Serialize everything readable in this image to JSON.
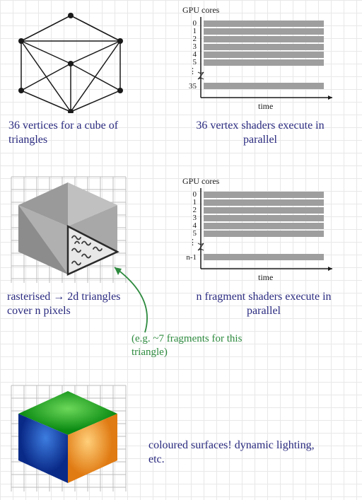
{
  "chart_data": [
    {
      "type": "bar",
      "title": "",
      "xlabel": "time",
      "ylabel": "GPU cores",
      "categories": [
        "0",
        "1",
        "2",
        "3",
        "4",
        "5",
        "⋮",
        "35"
      ],
      "values": [
        1,
        1,
        1,
        1,
        1,
        1,
        1,
        1
      ],
      "ylim": [
        0,
        1
      ]
    },
    {
      "type": "bar",
      "title": "",
      "xlabel": "time",
      "ylabel": "GPU cores",
      "categories": [
        "0",
        "1",
        "2",
        "3",
        "4",
        "5",
        "⋮",
        "n-1"
      ],
      "values": [
        1,
        1,
        1,
        1,
        1,
        1,
        1,
        1
      ],
      "ylim": [
        0,
        1
      ]
    }
  ],
  "captions": {
    "wire_cube": "36 vertices for a cube of triangles",
    "vertex_chart": "36 vertex shaders execute in parallel",
    "raster": "rasterised → 2d triangles cover n pixels",
    "fragment_chart": "n fragment shaders execute in parallel",
    "eg": "(e.g. ~7 fragments for this triangle)",
    "colour": "coloured surfaces! dynamic lighting, etc."
  }
}
